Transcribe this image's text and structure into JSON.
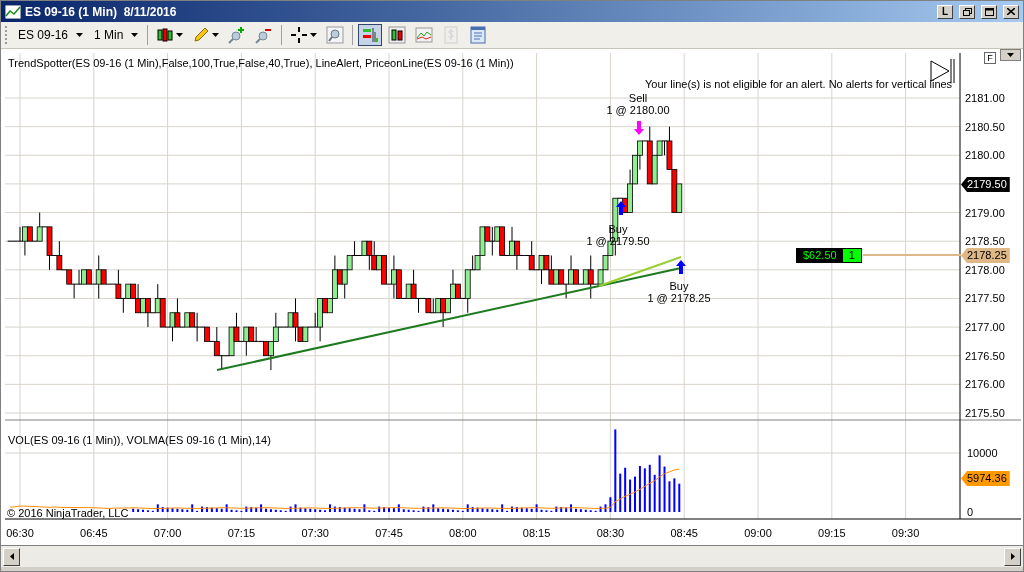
{
  "window": {
    "title": "ES 09-16 (1 Min)  8/11/2016"
  },
  "window_buttons": [
    {
      "kind": "text",
      "label": "L"
    },
    {
      "kind": "restore"
    },
    {
      "kind": "maximize"
    },
    {
      "kind": "close"
    }
  ],
  "toolbar": {
    "instrument": "ES 09-16",
    "interval": "1 Min",
    "tools": [
      {
        "kind": "candles",
        "dropdown": true,
        "selected": false,
        "disabled": false
      },
      {
        "kind": "pencil",
        "dropdown": true,
        "selected": false,
        "disabled": false
      },
      {
        "kind": "zoom-in",
        "dropdown": false,
        "selected": false,
        "disabled": false
      },
      {
        "kind": "zoom-out",
        "dropdown": false,
        "selected": false,
        "disabled": false
      },
      {
        "kind": "crosshair",
        "dropdown": true,
        "selected": false,
        "disabled": false
      },
      {
        "kind": "magnifier",
        "dropdown": false,
        "selected": false,
        "disabled": false
      },
      {
        "kind": "order-bars",
        "dropdown": false,
        "selected": true,
        "disabled": false
      },
      {
        "kind": "candles-framed",
        "dropdown": false,
        "selected": false,
        "disabled": false
      },
      {
        "kind": "line-chart",
        "dropdown": false,
        "selected": false,
        "disabled": false
      },
      {
        "kind": "dollar",
        "dropdown": false,
        "selected": false,
        "disabled": true
      },
      {
        "kind": "properties",
        "dropdown": false,
        "selected": false,
        "disabled": false
      }
    ]
  },
  "indicators_label": "TrendSpotter(ES 09-16 (1 Min),False,100,True,False,40,True), LineAlert, PriceonLine(ES 09-16 (1 Min))",
  "alert_message": "Your line(s) is not eligible for an alert. No alerts for vertical lines",
  "corner_button": "F",
  "executions": [
    {
      "kind": "sell",
      "action": "Sell",
      "fill": "1 @ 2180.00"
    },
    {
      "kind": "buy",
      "action": "Buy",
      "fill": "1 @ 2179.50"
    },
    {
      "kind": "buy",
      "action": "Buy",
      "fill": "1 @ 2178.25"
    }
  ],
  "price_axis": [
    "2181.00",
    "2180.50",
    "2180.00",
    "2179.00",
    "2178.50",
    "2178.00",
    "2177.50",
    "2177.00",
    "2176.50",
    "2176.00",
    "2175.50"
  ],
  "last_price_tag": "2179.50",
  "position_price_tag": "2178.25",
  "position": {
    "pnl": "$62.50",
    "quantity": "1"
  },
  "volume_panel": {
    "label": "VOL(ES 09-16 (1 Min)), VOLMA(ES 09-16 (1 Min),14)",
    "axis": [
      "10000",
      "0"
    ],
    "volma_tag": "5974.36"
  },
  "time_axis": [
    "06:30",
    "06:45",
    "07:00",
    "07:15",
    "07:30",
    "07:45",
    "08:00",
    "08:15",
    "08:30",
    "08:45",
    "09:00",
    "09:15",
    "09:30"
  ],
  "copyright": "© 2016 NinjaTrader, LLC"
}
